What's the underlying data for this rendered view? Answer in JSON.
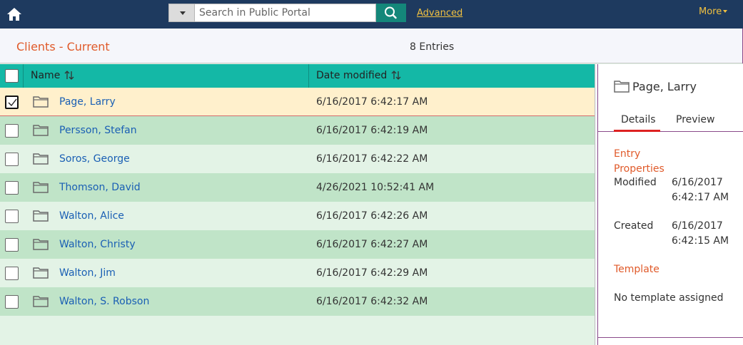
{
  "topbar": {
    "home_icon": "home-icon",
    "search_placeholder": "Search in Public Portal",
    "search_icon": "search-icon",
    "advanced_label": "Advanced",
    "more_label": "More",
    "accent_color": "#f0c040",
    "bar_color": "#1e3a5f"
  },
  "header": {
    "folder_title": "Clients - Current",
    "entries_count": "8 Entries"
  },
  "table": {
    "columns": {
      "name": "Name",
      "date": "Date modified"
    },
    "rows": [
      {
        "name": "Page, Larry",
        "date": "6/16/2017 6:42:17 AM",
        "selected": true
      },
      {
        "name": "Persson, Stefan",
        "date": "6/16/2017 6:42:19 AM",
        "selected": false
      },
      {
        "name": "Soros, George",
        "date": "6/16/2017 6:42:22 AM",
        "selected": false
      },
      {
        "name": "Thomson, David",
        "date": "4/26/2021 10:52:41 AM",
        "selected": false
      },
      {
        "name": "Walton, Alice",
        "date": "6/16/2017 6:42:26 AM",
        "selected": false
      },
      {
        "name": "Walton, Christy",
        "date": "6/16/2017 6:42:27 AM",
        "selected": false
      },
      {
        "name": "Walton, Jim",
        "date": "6/16/2017 6:42:29 AM",
        "selected": false
      },
      {
        "name": "Walton, S. Robson",
        "date": "6/16/2017 6:42:32 AM",
        "selected": false
      }
    ]
  },
  "pane": {
    "title": "Page, Larry",
    "tabs": {
      "details": "Details",
      "preview": "Preview"
    },
    "entry_properties_label": "Entry Properties",
    "modified_key": "Modified",
    "modified_value": "6/16/2017 6:42:17 AM",
    "created_key": "Created",
    "created_value": "6/16/2017 6:42:15 AM",
    "template_label": "Template",
    "template_value": "No template assigned"
  }
}
